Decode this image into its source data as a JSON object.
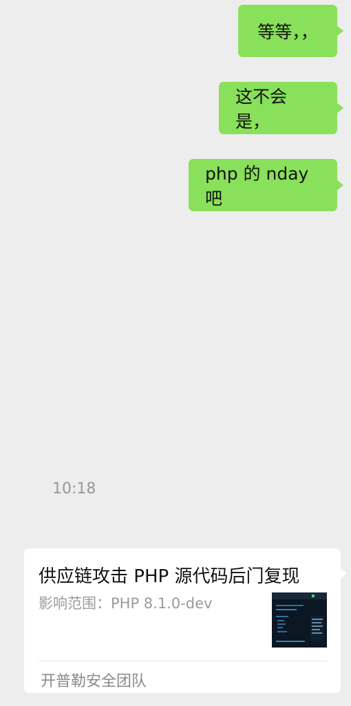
{
  "messages": [
    {
      "text": "等等，，"
    },
    {
      "text": "这不会是，"
    },
    {
      "text": "php 的 nday 吧"
    }
  ],
  "timestamp": "10:18",
  "link_card": {
    "title": "供应链攻击 PHP 源代码后门复现",
    "description": "影响范围：PHP 8.1.0-dev",
    "source": "开普勒安全团队",
    "thumbnail_icon": "article-thumbnail-image"
  },
  "colors": {
    "background": "#ededed",
    "sent_bubble": "#89e05a",
    "card_background": "#ffffff",
    "secondary_text": "#9a9a9a"
  }
}
